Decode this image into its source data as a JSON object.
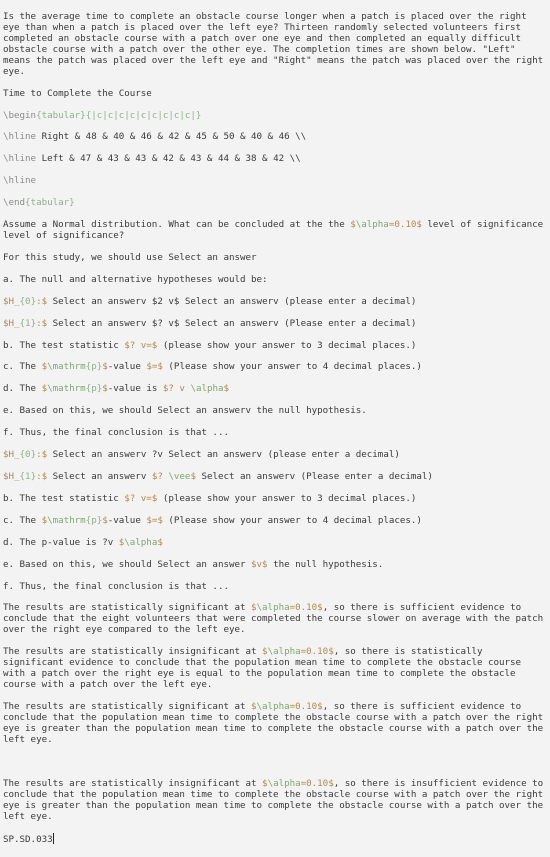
{
  "editor": {
    "intro": "Is the average time to complete an obstacle course longer when a patch is placed over the right eye than when a patch is placed over the left eye? Thirteen randomly selected volunteers first completed an obstacle course with a patch over one eye and then completed an equally difficult obstacle course with a patch over the other eye. The completion times are shown below. \"Left\" means the patch was placed over the left eye and \"Right\" means the patch was placed over the right eye.",
    "table_title": "Time to Complete the Course",
    "table": {
      "begin_cmd": "\\begin",
      "begin_env": "{tabular}",
      "begin_spec": "{|c|c|c|c|c|c|c|c|c|}",
      "hline": "\\hline",
      "rows": [
        {
          "label": "Right",
          "values": [
            "48",
            "40",
            "46",
            "42",
            "45",
            "50",
            "40",
            "46"
          ],
          "text": " Right & 48 & 40 & 46 & 42 & 45 & 50 & 40 & 46 \\\\"
        },
        {
          "label": "Left",
          "values": [
            "47",
            "43",
            "43",
            "42",
            "43",
            "44",
            "38",
            "42"
          ],
          "text": " Left & 47 & 43 & 43 & 42 & 43 & 44 & 38 & 42 \\\\"
        }
      ],
      "end_cmd": "\\end",
      "end_env": "{tabular}"
    },
    "question": {
      "pre": "Assume a Normal distribution. What can be concluded at the the ",
      "alpha_math": "$\\alpha=0.10$",
      "post": " level of significance level of significance?"
    },
    "study_line": "For this study, we should use Select an answer",
    "part_a": "a. The null and alternative hypotheses would be:",
    "h0_1": {
      "math": "$H_{0}:$",
      "rest": " Select an answerv $2 v$ Select an answerv (please enter a decimal)"
    },
    "h1_1": {
      "math": "$H_{1}:$",
      "rest": " Select an answerv $? v$ Select an answerv (Please enter a decimal)"
    },
    "part_b1": {
      "pre": "b. The test statistic ",
      "math": "$? v=$",
      "post": " (please show your answer to 3 decimal places.)"
    },
    "part_c1": {
      "pre": "c. The ",
      "math": "$\\mathrm{p}$",
      "mid": "-value ",
      "math2": "$=$",
      "post": " (Please show your answer to 4 decimal places.)"
    },
    "part_d1": {
      "pre": "d. The ",
      "math": "$\\mathrm{p}$",
      "mid": "-value is ",
      "math2": "$? v \\alpha$"
    },
    "part_e1": "e. Based on this, we should Select an answerv the null hypothesis.",
    "part_f1": "f. Thus, the final conclusion is that ...",
    "h0_2": {
      "math": "$H_{0}:$",
      "rest": " Select an answerv ?v Select an answerv (please enter a decimal)"
    },
    "h1_2": {
      "math": "$H_{1}:$",
      "rest": " Select an answerv ",
      "math2": "$? \\vee$",
      "rest2": " Select an answerv (Please enter a decimal)"
    },
    "part_b2": {
      "pre": "b. The test statistic ",
      "math": "$? v=$",
      "post": " (please show your answer to 3 decimal places.)"
    },
    "part_c2": {
      "pre": "c. The ",
      "math": "$\\mathrm{p}$",
      "mid": "-value ",
      "math2": "$=$",
      "post": " (Please show your answer to 4 decimal places.)"
    },
    "part_d2": {
      "pre": "d. The p-value is ?v ",
      "math": "$\\alpha$"
    },
    "part_e2": {
      "pre": "e. Based on this, we should Select an answer ",
      "math": "$v$",
      "post": " the null hypothesis."
    },
    "part_f2": "f. Thus, the final conclusion is that ...",
    "options": [
      {
        "pre": "The results are statistically significant at ",
        "math": "$\\alpha=0.10$",
        "post": ", so there is sufficient evidence to conclude that the eight volunteers that were completed the course slower on average with the patch over the right eye compared to the left eye."
      },
      {
        "pre": "The results are statistically insignificant at ",
        "math": "$\\alpha=0.10$",
        "post": ", so there is statistically significant evidence to conclude that the population mean time to complete the obstacle course with a patch over the right eye is equal to the population mean time to complete the obstacle course with a patch over the left eye."
      },
      {
        "pre": "The results are statistically significant at ",
        "math": "$\\alpha=0.10$",
        "post": ", so there is sufficient evidence to conclude that the population mean time to complete the obstacle course with a patch over the right eye is greater than the population mean time to complete the obstacle course with a patch over the left eye."
      },
      {
        "pre": "The results are statistically insignificant at ",
        "math": "$\\alpha=0.10$",
        "post": ", so there is insufficient evidence to conclude that the population mean time to complete the obstacle course with a patch over the right eye is greater than the population mean time to complete the obstacle course with a patch over the left eye."
      }
    ],
    "footer_code": "SP.SD.033"
  }
}
